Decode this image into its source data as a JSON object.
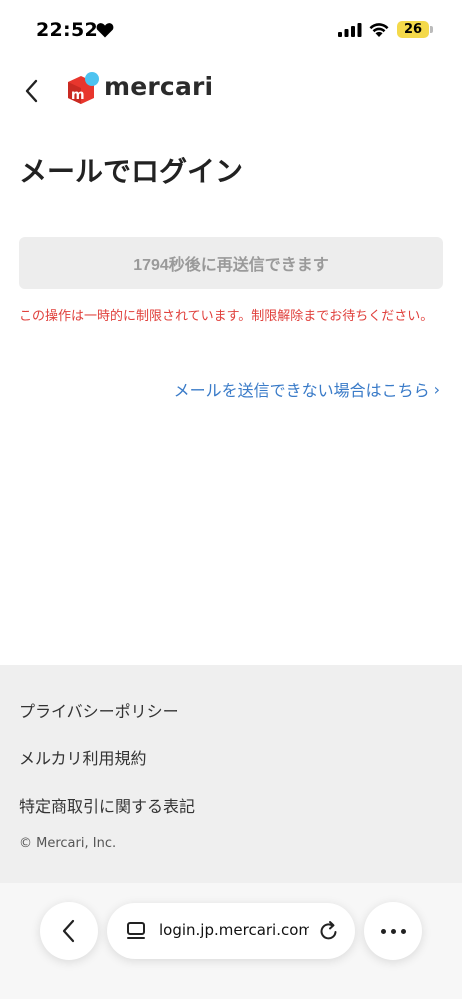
{
  "status": {
    "time": "22:52",
    "battery": "26"
  },
  "header": {
    "logo_text": "mercari"
  },
  "page": {
    "title": "メールでログイン",
    "resend_button": "1794秒後に再送信できます",
    "error_message": "この操作は一時的に制限されています。制限解除までお待ちください。",
    "help_link": "メールを送信できない場合はこちら",
    "help_chevron": "›"
  },
  "footer": {
    "links": [
      "プライバシーポリシー",
      "メルカリ利用規約",
      "特定商取引に関する表記"
    ],
    "copyright": "© Mercari, Inc."
  },
  "browser": {
    "url": "login.jp.mercari.com"
  },
  "colors": {
    "error": "#e0403c",
    "link": "#3a7bc8",
    "brand_red": "#e8362d",
    "brand_blue": "#4dc3f0",
    "battery": "#f4d94a"
  },
  "icons": {
    "back": "chevron-left-icon",
    "heart": "heart-icon",
    "signal": "cellular-signal-icon",
    "wifi": "wifi-icon",
    "tabs": "tabs-icon",
    "reload": "reload-icon",
    "more": "more-icon"
  }
}
